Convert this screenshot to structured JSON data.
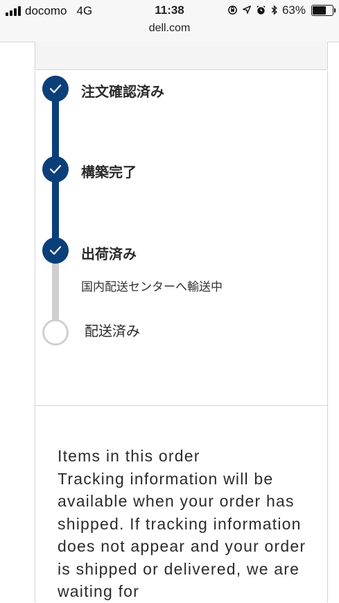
{
  "status_bar": {
    "carrier": "docomo",
    "network": "4G",
    "time": "11:38",
    "battery": "63%",
    "battery_level": 0.63,
    "icons": [
      "orientation-lock-icon",
      "location-arrow-icon",
      "alarm-icon",
      "bluetooth-icon",
      "battery-icon"
    ]
  },
  "browser": {
    "url": "dell.com"
  },
  "order_status": {
    "steps": [
      {
        "label": "注文確認済み",
        "state": "done"
      },
      {
        "label": "構築完了",
        "state": "done"
      },
      {
        "label": "出荷済み",
        "state": "done",
        "detail": "国内配送センターへ輸送中"
      },
      {
        "label": "配送済み",
        "state": "pending"
      }
    ]
  },
  "items_section": {
    "title": "Items in this order",
    "body": "Tracking information will be available when your order has shipped. If tracking information does not appear and your order is shipped or delivered, we are waiting for"
  },
  "colors": {
    "accent": "#0b3f7a",
    "pending": "#cfcfcf"
  }
}
